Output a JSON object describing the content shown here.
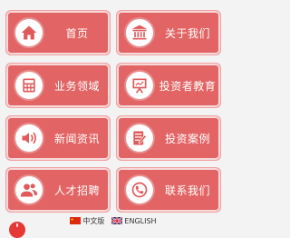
{
  "menu": {
    "items": [
      {
        "id": "home",
        "label": "首页",
        "icon": "home-icon"
      },
      {
        "id": "about",
        "label": "关于我们",
        "icon": "building-icon"
      },
      {
        "id": "business",
        "label": "业务领域",
        "icon": "calculator-icon"
      },
      {
        "id": "education",
        "label": "投资者教育",
        "icon": "presentation-board-icon"
      },
      {
        "id": "news",
        "label": "新闻资讯",
        "icon": "speaker-icon"
      },
      {
        "id": "cases",
        "label": "投资案例",
        "icon": "document-edit-icon"
      },
      {
        "id": "careers",
        "label": "人才招聘",
        "icon": "users-icon"
      },
      {
        "id": "contact",
        "label": "联系我们",
        "icon": "phone-icon"
      }
    ]
  },
  "language": {
    "chinese_label": "中文版",
    "english_label": "ENGLISH"
  },
  "colors": {
    "tile": "#e26464",
    "tile_border": "#f0a0a0",
    "icon_fg": "#e05a5a",
    "background": "#f3f3f3"
  }
}
